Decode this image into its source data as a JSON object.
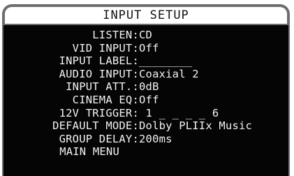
{
  "title": "INPUT SETUP",
  "rows": [
    {
      "label": "LISTEN:",
      "value": "CD"
    },
    {
      "label": "VID INPUT:",
      "value": "Off"
    },
    {
      "label": "INPUT LABEL:",
      "value": "________"
    },
    {
      "label": "AUDIO INPUT:",
      "value": "Coaxial 2"
    },
    {
      "label": "INPUT ATT.:",
      "value": "0dB"
    },
    {
      "label": "CINEMA EQ:",
      "value": "Off"
    },
    {
      "label": "12V TRIGGER:",
      "value": " 1 _ _ _ _ 6"
    },
    {
      "label": "DEFAULT MODE:",
      "value": "Dolby PLIIx Music"
    },
    {
      "label": "GROUP DELAY:",
      "value": "200ms"
    }
  ],
  "main_menu_label": "MAIN MENU",
  "colors": {
    "screen_background": "#050505",
    "text": "#f2f2f2",
    "title_bar": "#ffffff",
    "border": "#6d6d6d"
  }
}
